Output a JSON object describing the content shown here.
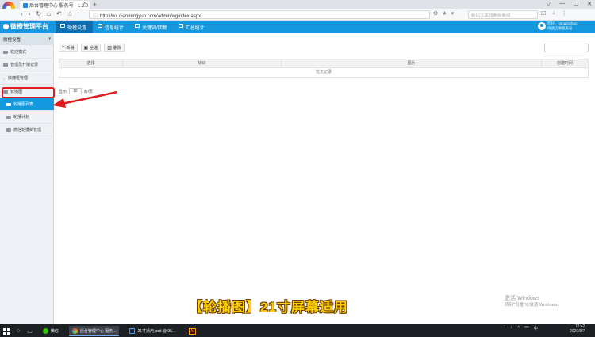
{
  "browser": {
    "tab_title": "后台管理中心 服务号 - 1.2.0",
    "tab_close": "×",
    "tab_add": "+",
    "window_buttons": [
      "▽",
      "—",
      "☐",
      "✕"
    ],
    "nav_buttons": [
      "‹",
      "›",
      "↻",
      "⌂",
      "↶",
      "☆"
    ],
    "address": "http://wx.qianmingyun.com/admin/wgindex.aspx",
    "search_placeholder": "新出大家园新街新闻",
    "tools": [
      "☐",
      "↓",
      "⋮"
    ]
  },
  "header": {
    "brand": "微橙管理平台",
    "nav": [
      "微橙设置",
      "信息统计",
      "关键词/回复",
      "汇总统计"
    ],
    "user_line1": "您好，yangjiazhuo",
    "user_line2": "快速切换服务号"
  },
  "sidebar": {
    "section": "微橙设置",
    "items": [
      {
        "label": "欢迎模式"
      },
      {
        "label": "管理员开播记录"
      },
      {
        "label": "快捷框管理"
      },
      {
        "label": "轮播图"
      }
    ],
    "subitems": [
      {
        "label": "轮播图列表"
      },
      {
        "label": "轮播计划"
      },
      {
        "label": "微信轮播新管理"
      }
    ]
  },
  "toolbar": {
    "new": "新增",
    "all": "全选",
    "delete": "删除"
  },
  "table": {
    "columns": [
      "选择",
      "标识",
      "图片",
      "创建时间"
    ],
    "empty": "暂无记录"
  },
  "pager": {
    "show_label": "显示",
    "page_size": "10",
    "unit_label": "条/页"
  },
  "caption": "【轮播图】21寸屏幕适用",
  "watermark": {
    "line1": "激活 Windows",
    "line2": "转到\"设置\"以激活 Windows。"
  },
  "taskbar": {
    "apps": [
      "微信",
      "后台管理中心 服务...",
      "21寸适用.psd @ 95...",
      "Ai"
    ],
    "time": "11:42",
    "date": "2020/8/7"
  },
  "colors": {
    "accent": "#1598de",
    "highlight": "#e01b1b",
    "caption": "#ffd200"
  }
}
